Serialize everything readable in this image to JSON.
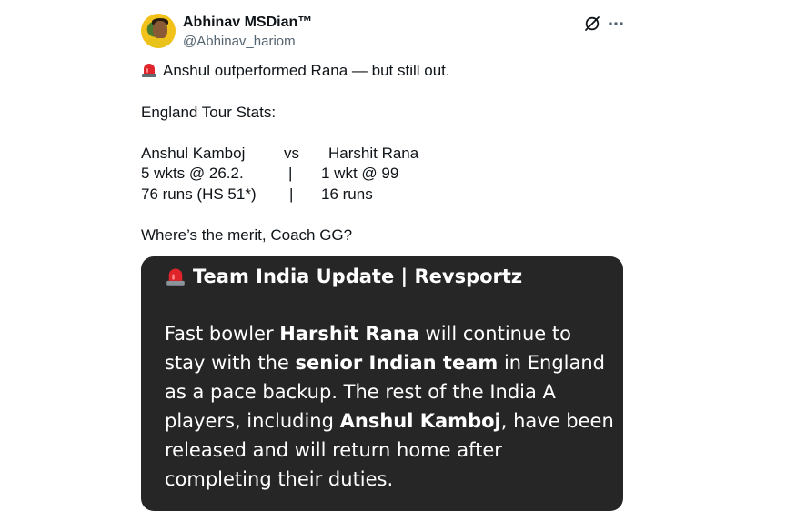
{
  "author": {
    "display_name": "Abhinav MSDian™",
    "handle": "@Abhinav_hariom"
  },
  "icons": {
    "grok": "grok-icon",
    "more": "more-icon",
    "siren": "police-siren-icon",
    "avatar": "avatar-photo"
  },
  "tweet": {
    "headline": "Anshul outperformed Rana — but still out.",
    "stats_title": "England Tour Stats:",
    "comparison": {
      "left_name": "Anshul Kamboj",
      "vs": "vs",
      "right_name": "Harshit Rana",
      "rows": [
        {
          "left": "5 wkts @ 26.2.",
          "sep": "|",
          "right": "1 wkt @ 99"
        },
        {
          "left": "76 runs (HS 51*)",
          "sep": "|",
          "right": "16 runs"
        }
      ]
    },
    "question": "Where’s the merit, Coach GG?"
  },
  "media_card": {
    "header": "Team India Update | Revsportz",
    "body": {
      "t1": "Fast bowler ",
      "b1": "Harshit Rana",
      "t2": " will continue to stay with the ",
      "b2": "senior Indian team",
      "t3": " in England as a pace backup. The rest of the India A players, including ",
      "b3": "Anshul Kamboj",
      "t4": ", have been released and will return home after completing their duties."
    }
  },
  "colors": {
    "text_primary": "#0f1419",
    "text_secondary": "#536471",
    "card_background": "#262626",
    "siren_red": "#e0242b"
  }
}
